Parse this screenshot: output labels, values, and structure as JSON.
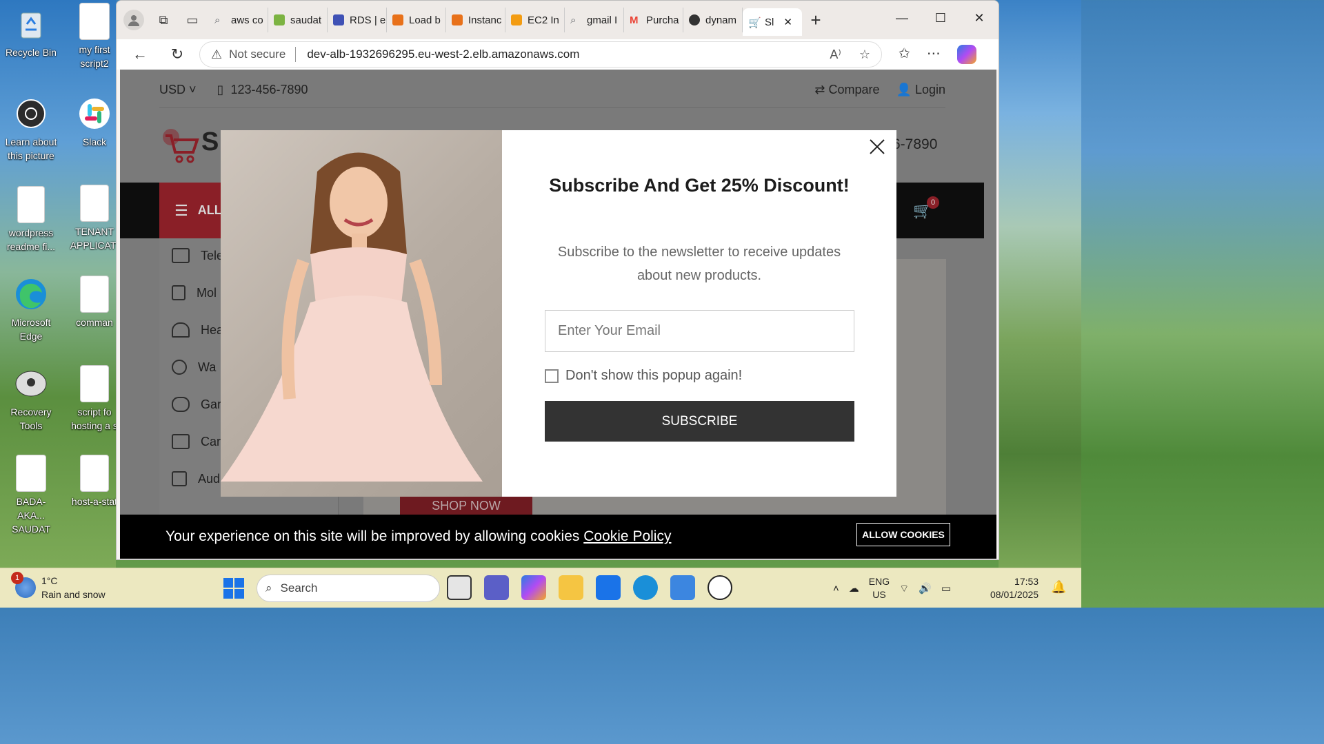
{
  "desktop": {
    "icons": [
      {
        "label": "Recycle Bin"
      },
      {
        "label": "my first script2"
      },
      {
        "label": "Learn about this picture"
      },
      {
        "label": "Slack"
      },
      {
        "label": "wordpress readme fi..."
      },
      {
        "label": "TENANT APPLICATI"
      },
      {
        "label": "Microsoft Edge"
      },
      {
        "label": "comman"
      },
      {
        "label": "Recovery Tools"
      },
      {
        "label": "script fo hosting a s"
      },
      {
        "label": "BADA-AKA... SAUDAT"
      },
      {
        "label": "host-a-stat"
      }
    ]
  },
  "browser": {
    "tabs": [
      {
        "label": "aws co",
        "color": "#5f6368"
      },
      {
        "label": "saudat",
        "color": "#7cb342"
      },
      {
        "label": "RDS | e",
        "color": "#3f51b5"
      },
      {
        "label": "Load b",
        "color": "#e8711a"
      },
      {
        "label": "Instanc",
        "color": "#e8711a"
      },
      {
        "label": "EC2 In",
        "color": "#f39c12"
      },
      {
        "label": "gmail I",
        "color": "#5f6368"
      },
      {
        "label": "Purcha",
        "color": "#ea4335"
      },
      {
        "label": "dynam",
        "color": "#333333"
      },
      {
        "label": "Sl",
        "color": "#d13c4a"
      }
    ],
    "address": {
      "security": "Not secure",
      "url": "dev-alb-1932696295.eu-west-2.elb.amazonaws.com"
    }
  },
  "site": {
    "currency": "USD",
    "phone": "123-456-7890",
    "compare": "Compare",
    "login": "Login",
    "logo_text": "Sl",
    "header_phone": "6-7890",
    "all_categories": "ALL",
    "cart_count": "0",
    "menu": [
      "Tele",
      "Mol",
      "Hea",
      "Wa",
      "Gar",
      "Car",
      "Aud"
    ],
    "shop_now": "SHOP NOW",
    "brand_red": "#c0272d"
  },
  "modal": {
    "title": "Subscribe And Get 25% Discount!",
    "subtitle": "Subscribe to the newsletter to receive updates about new products.",
    "email_placeholder": "Enter Your Email",
    "dont_show": "Don't show this popup again!",
    "subscribe": "SUBSCRIBE"
  },
  "cookie": {
    "text": "Your experience on this site will be improved by allowing cookies",
    "link": "Cookie Policy",
    "button": "ALLOW COOKIES"
  },
  "taskbar": {
    "weather_badge": "1",
    "temp": "1°C",
    "condition": "Rain and snow",
    "search": "Search",
    "lang1": "ENG",
    "lang2": "US",
    "time": "17:53",
    "date": "08/01/2025"
  }
}
